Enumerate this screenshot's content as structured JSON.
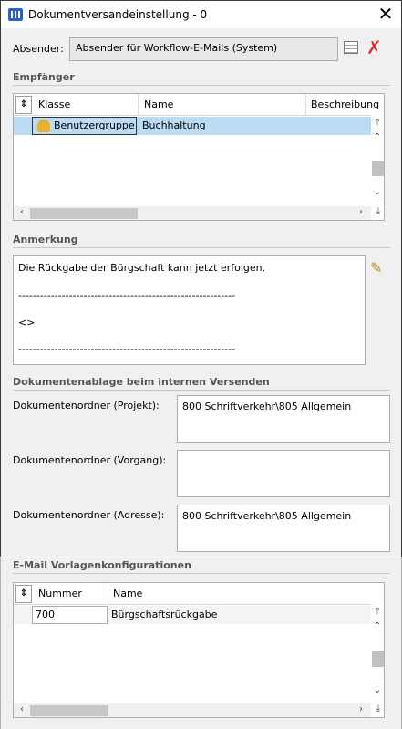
{
  "window": {
    "title": "Dokumentversandeinstellung - 0",
    "close": "✕"
  },
  "sender": {
    "label": "Absender:",
    "value": "Absender für Workflow-E-Mails (System)"
  },
  "recipients": {
    "section": "Empfänger",
    "columns": [
      "Klasse",
      "Name",
      "Beschreibung"
    ],
    "rows": [
      {
        "klasse": "Benutzergruppe",
        "name": "Buchhaltung",
        "beschreibung": ""
      }
    ]
  },
  "note": {
    "section": "Anmerkung",
    "lines": [
      "Die Rückgabe der Bürgschaft kann jetzt erfolgen.",
      "------------------------------------------------------------",
      "<>",
      "------------------------------------------------------------"
    ]
  },
  "storage": {
    "section": "Dokumentenablage beim internen Versenden",
    "project_label": "Dokumentenordner (Projekt):",
    "project_value": "800 Schriftverkehr\\805 Allgemein",
    "process_label": "Dokumentenordner (Vorgang):",
    "process_value": "",
    "address_label": "Dokumentenordner (Adresse):",
    "address_value": "800 Schriftverkehr\\805 Allgemein"
  },
  "templates": {
    "section": "E-Mail Vorlagenkonfigurationen",
    "columns": [
      "Nummer",
      "Name"
    ],
    "rows": [
      {
        "nummer": "700",
        "name": "Bürgschaftsrückgabe"
      }
    ]
  },
  "icons": {
    "sort": "⇕",
    "up_top": "⤒",
    "up": "⌃",
    "down": "⌄",
    "down_bottom": "⤓",
    "left": "‹",
    "right": "›"
  },
  "colors": {
    "selection": "#bcdcf4",
    "accent": "#2a62c9",
    "delete": "#d32f2f"
  }
}
